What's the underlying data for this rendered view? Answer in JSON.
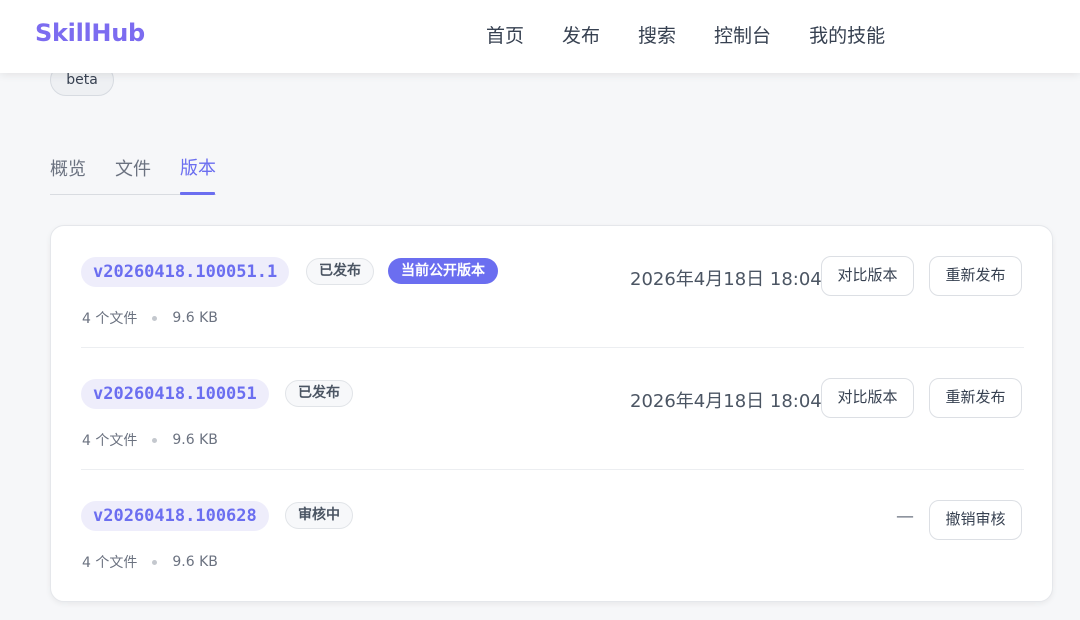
{
  "header": {
    "logo": "SkillHub",
    "nav": [
      "首页",
      "发布",
      "搜索",
      "控制台",
      "我的技能"
    ]
  },
  "tag": "beta",
  "tabs": [
    {
      "label": "概览",
      "active": false
    },
    {
      "label": "文件",
      "active": false
    },
    {
      "label": "版本",
      "active": true
    }
  ],
  "versions": [
    {
      "version": "v20260418.100051.1",
      "status": "已发布",
      "current_badge": "当前公开版本",
      "files": "4 个文件",
      "size": "9.6 KB",
      "date": "2026年4月18日 18:04",
      "actions": [
        "对比版本",
        "重新发布"
      ]
    },
    {
      "version": "v20260418.100051",
      "status": "已发布",
      "files": "4 个文件",
      "size": "9.6 KB",
      "date": "2026年4月18日 18:04",
      "actions": [
        "对比版本",
        "重新发布"
      ]
    },
    {
      "version": "v20260418.100628",
      "status": "审核中",
      "files": "4 个文件",
      "size": "9.6 KB",
      "date": "—",
      "actions": [
        "撤销审核"
      ]
    }
  ],
  "colors": {
    "accent": "#6b6ef0",
    "logo": "#7c6cf0",
    "background": "#f6f7f9"
  }
}
